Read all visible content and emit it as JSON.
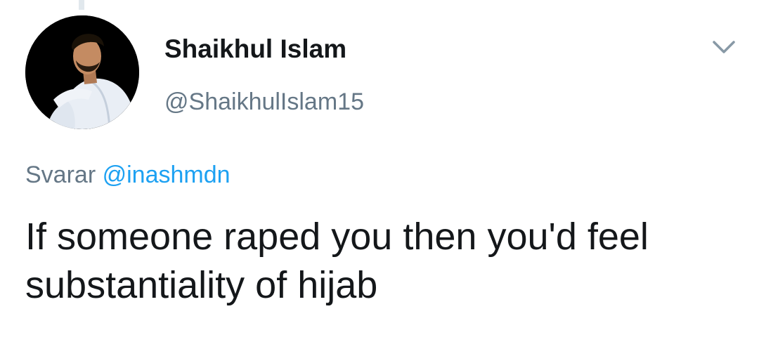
{
  "tweet": {
    "author": {
      "display_name": "Shaikhul Islam",
      "handle": "@ShaikhulIslam15"
    },
    "reply_prefix": "Svarar",
    "reply_to": "@inashmdn",
    "text": "If someone raped you then you'd feel substantiality of hijab"
  },
  "icons": {
    "caret": "chevron-down-icon",
    "avatar": "avatar-photo"
  },
  "colors": {
    "text_primary": "#14171a",
    "text_secondary": "#657786",
    "link": "#1da1f2",
    "thread_line": "#e1e8ed",
    "avatar_bg": "#000000"
  }
}
